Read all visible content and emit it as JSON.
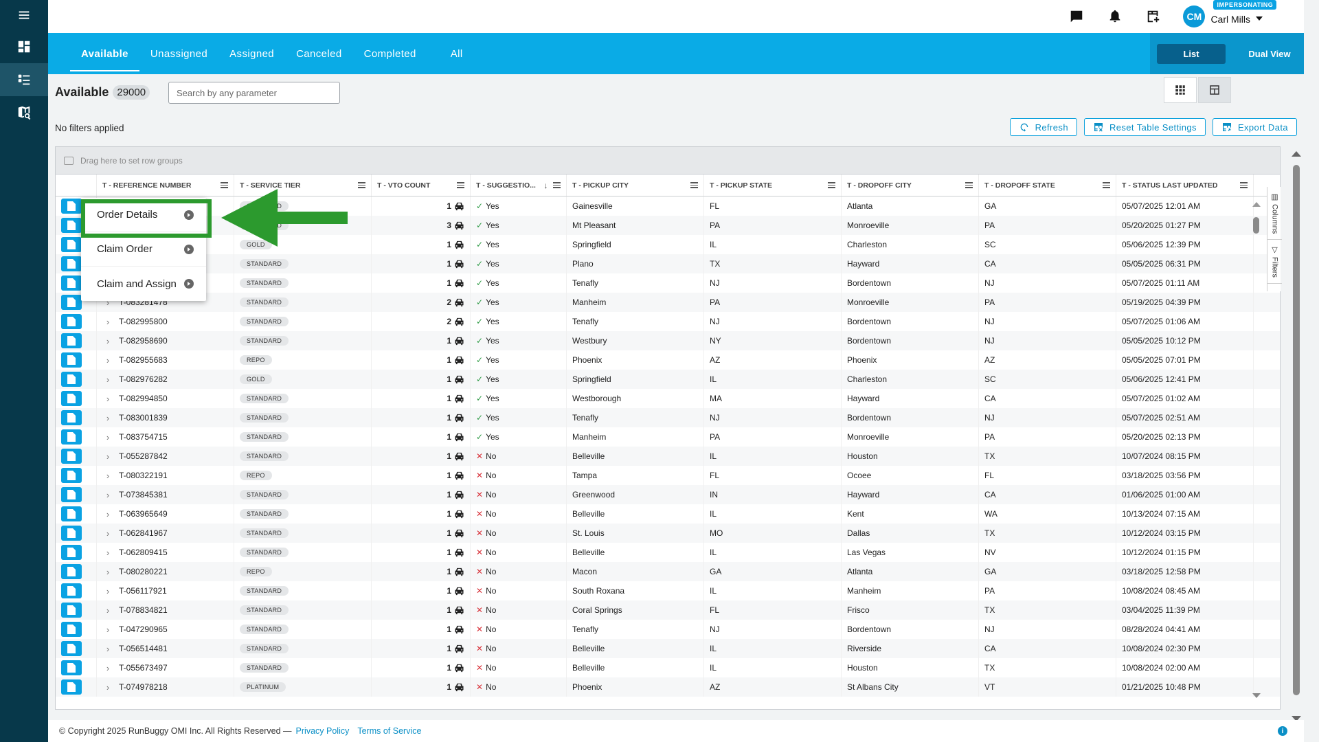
{
  "header": {
    "user_name": "Carl Mills",
    "user_initials": "CM",
    "impersonating_badge": "IMPERSONATING",
    "icons": [
      "chat-icon",
      "bell-icon",
      "grid-add-icon"
    ]
  },
  "tabs": [
    "Available",
    "Unassigned",
    "Assigned",
    "Canceled",
    "Completed",
    "All"
  ],
  "active_tab": "Available",
  "view_switch": {
    "list": "List",
    "dual": "Dual View",
    "active": "List"
  },
  "page": {
    "title": "Available",
    "count": "29000",
    "search_placeholder": "Search by any parameter",
    "filters_text": "No filters applied"
  },
  "actions": {
    "refresh": "Refresh",
    "reset": "Reset Table Settings",
    "export": "Export Data"
  },
  "grid": {
    "group_placeholder": "Drag here to set row groups",
    "columns": [
      "T - REFERENCE NUMBER",
      "T - SERVICE TIER",
      "T - VTO COUNT",
      "T - SUGGESTIO...",
      "T - PICKUP CITY",
      "T - PICKUP STATE",
      "T - DROPOFF CITY",
      "T - DROPOFF STATE",
      "T - STATUS LAST UPDATED"
    ],
    "side_tabs": [
      "Columns",
      "Filters"
    ],
    "rows": [
      {
        "ref": "",
        "tier": "STANDARD",
        "vto": "1",
        "sugg": "Yes",
        "pcity": "Gainesville",
        "pstate": "FL",
        "dcity": "Atlanta",
        "dstate": "GA",
        "updated": "05/07/2025 12:01 AM"
      },
      {
        "ref": "",
        "tier": "STANDARD",
        "vto": "3",
        "sugg": "Yes",
        "pcity": "Mt Pleasant",
        "pstate": "PA",
        "dcity": "Monroeville",
        "dstate": "PA",
        "updated": "05/20/2025 01:27 PM"
      },
      {
        "ref": "",
        "tier": "GOLD",
        "vto": "1",
        "sugg": "Yes",
        "pcity": "Springfield",
        "pstate": "IL",
        "dcity": "Charleston",
        "dstate": "SC",
        "updated": "05/06/2025 12:39 PM"
      },
      {
        "ref": "",
        "tier": "STANDARD",
        "vto": "1",
        "sugg": "Yes",
        "pcity": "Plano",
        "pstate": "TX",
        "dcity": "Hayward",
        "dstate": "CA",
        "updated": "05/05/2025 06:31 PM"
      },
      {
        "ref": "",
        "tier": "STANDARD",
        "vto": "1",
        "sugg": "Yes",
        "pcity": "Tenafly",
        "pstate": "NJ",
        "dcity": "Bordentown",
        "dstate": "NJ",
        "updated": "05/07/2025 01:11 AM"
      },
      {
        "ref": "T-083281478",
        "tier": "STANDARD",
        "vto": "2",
        "sugg": "Yes",
        "pcity": "Manheim",
        "pstate": "PA",
        "dcity": "Monroeville",
        "dstate": "PA",
        "updated": "05/19/2025 04:39 PM"
      },
      {
        "ref": "T-082995800",
        "tier": "STANDARD",
        "vto": "2",
        "sugg": "Yes",
        "pcity": "Tenafly",
        "pstate": "NJ",
        "dcity": "Bordentown",
        "dstate": "NJ",
        "updated": "05/07/2025 01:06 AM"
      },
      {
        "ref": "T-082958690",
        "tier": "STANDARD",
        "vto": "1",
        "sugg": "Yes",
        "pcity": "Westbury",
        "pstate": "NY",
        "dcity": "Bordentown",
        "dstate": "NJ",
        "updated": "05/05/2025 10:12 PM"
      },
      {
        "ref": "T-082955683",
        "tier": "REPO",
        "vto": "1",
        "sugg": "Yes",
        "pcity": "Phoenix",
        "pstate": "AZ",
        "dcity": "Phoenix",
        "dstate": "AZ",
        "updated": "05/05/2025 07:01 PM"
      },
      {
        "ref": "T-082976282",
        "tier": "GOLD",
        "vto": "1",
        "sugg": "Yes",
        "pcity": "Springfield",
        "pstate": "IL",
        "dcity": "Charleston",
        "dstate": "SC",
        "updated": "05/06/2025 12:41 PM"
      },
      {
        "ref": "T-082994850",
        "tier": "STANDARD",
        "vto": "1",
        "sugg": "Yes",
        "pcity": "Westborough",
        "pstate": "MA",
        "dcity": "Hayward",
        "dstate": "CA",
        "updated": "05/07/2025 01:02 AM"
      },
      {
        "ref": "T-083001839",
        "tier": "STANDARD",
        "vto": "1",
        "sugg": "Yes",
        "pcity": "Tenafly",
        "pstate": "NJ",
        "dcity": "Bordentown",
        "dstate": "NJ",
        "updated": "05/07/2025 02:51 AM"
      },
      {
        "ref": "T-083754715",
        "tier": "STANDARD",
        "vto": "1",
        "sugg": "Yes",
        "pcity": "Manheim",
        "pstate": "PA",
        "dcity": "Monroeville",
        "dstate": "PA",
        "updated": "05/20/2025 02:13 PM"
      },
      {
        "ref": "T-055287842",
        "tier": "STANDARD",
        "vto": "1",
        "sugg": "No",
        "pcity": "Belleville",
        "pstate": "IL",
        "dcity": "Houston",
        "dstate": "TX",
        "updated": "10/07/2024 08:15 PM"
      },
      {
        "ref": "T-080322191",
        "tier": "REPO",
        "vto": "1",
        "sugg": "No",
        "pcity": "Tampa",
        "pstate": "FL",
        "dcity": "Ocoee",
        "dstate": "FL",
        "updated": "03/18/2025 03:56 PM"
      },
      {
        "ref": "T-073845381",
        "tier": "STANDARD",
        "vto": "1",
        "sugg": "No",
        "pcity": "Greenwood",
        "pstate": "IN",
        "dcity": "Hayward",
        "dstate": "CA",
        "updated": "01/06/2025 01:00 AM"
      },
      {
        "ref": "T-063965649",
        "tier": "STANDARD",
        "vto": "1",
        "sugg": "No",
        "pcity": "Belleville",
        "pstate": "IL",
        "dcity": "Kent",
        "dstate": "WA",
        "updated": "10/13/2024 07:15 AM"
      },
      {
        "ref": "T-062841967",
        "tier": "STANDARD",
        "vto": "1",
        "sugg": "No",
        "pcity": "St. Louis",
        "pstate": "MO",
        "dcity": "Dallas",
        "dstate": "TX",
        "updated": "10/12/2024 03:15 PM"
      },
      {
        "ref": "T-062809415",
        "tier": "STANDARD",
        "vto": "1",
        "sugg": "No",
        "pcity": "Belleville",
        "pstate": "IL",
        "dcity": "Las Vegas",
        "dstate": "NV",
        "updated": "10/12/2024 01:15 PM"
      },
      {
        "ref": "T-080280221",
        "tier": "REPO",
        "vto": "1",
        "sugg": "No",
        "pcity": "Macon",
        "pstate": "GA",
        "dcity": "Atlanta",
        "dstate": "GA",
        "updated": "03/18/2025 12:58 PM"
      },
      {
        "ref": "T-056117921",
        "tier": "STANDARD",
        "vto": "1",
        "sugg": "No",
        "pcity": "South Roxana",
        "pstate": "IL",
        "dcity": "Manheim",
        "dstate": "PA",
        "updated": "10/08/2024 08:45 AM"
      },
      {
        "ref": "T-078834821",
        "tier": "STANDARD",
        "vto": "1",
        "sugg": "No",
        "pcity": "Coral Springs",
        "pstate": "FL",
        "dcity": "Frisco",
        "dstate": "TX",
        "updated": "03/04/2025 11:39 PM"
      },
      {
        "ref": "T-047290965",
        "tier": "STANDARD",
        "vto": "1",
        "sugg": "No",
        "pcity": "Tenafly",
        "pstate": "NJ",
        "dcity": "Bordentown",
        "dstate": "NJ",
        "updated": "08/28/2024 04:41 AM"
      },
      {
        "ref": "T-056514481",
        "tier": "STANDARD",
        "vto": "1",
        "sugg": "No",
        "pcity": "Belleville",
        "pstate": "IL",
        "dcity": "Riverside",
        "dstate": "CA",
        "updated": "10/08/2024 02:30 PM"
      },
      {
        "ref": "T-055673497",
        "tier": "STANDARD",
        "vto": "1",
        "sugg": "No",
        "pcity": "Belleville",
        "pstate": "IL",
        "dcity": "Houston",
        "dstate": "TX",
        "updated": "10/08/2024 02:00 AM"
      },
      {
        "ref": "T-074978218",
        "tier": "PLATINUM",
        "vto": "1",
        "sugg": "No",
        "pcity": "Phoenix",
        "pstate": "AZ",
        "dcity": "St Albans City",
        "dstate": "VT",
        "updated": "01/21/2025 10:48 PM"
      }
    ]
  },
  "context_menu": [
    "Order Details",
    "Claim Order",
    "Claim and Assign"
  ],
  "highlighted_item": "Order Details",
  "colors": {
    "rail": "#07384a",
    "band": "#0aabe6",
    "accent": "#0aa2e3",
    "highlight": "#2c9a2e",
    "yes": "#2c9a43",
    "no": "#d9363e"
  },
  "footer": {
    "copyright": "© Copyright 2025 RunBuggy OMI Inc. All Rights Reserved —",
    "privacy": "Privacy Policy",
    "terms": "Terms of Service"
  }
}
